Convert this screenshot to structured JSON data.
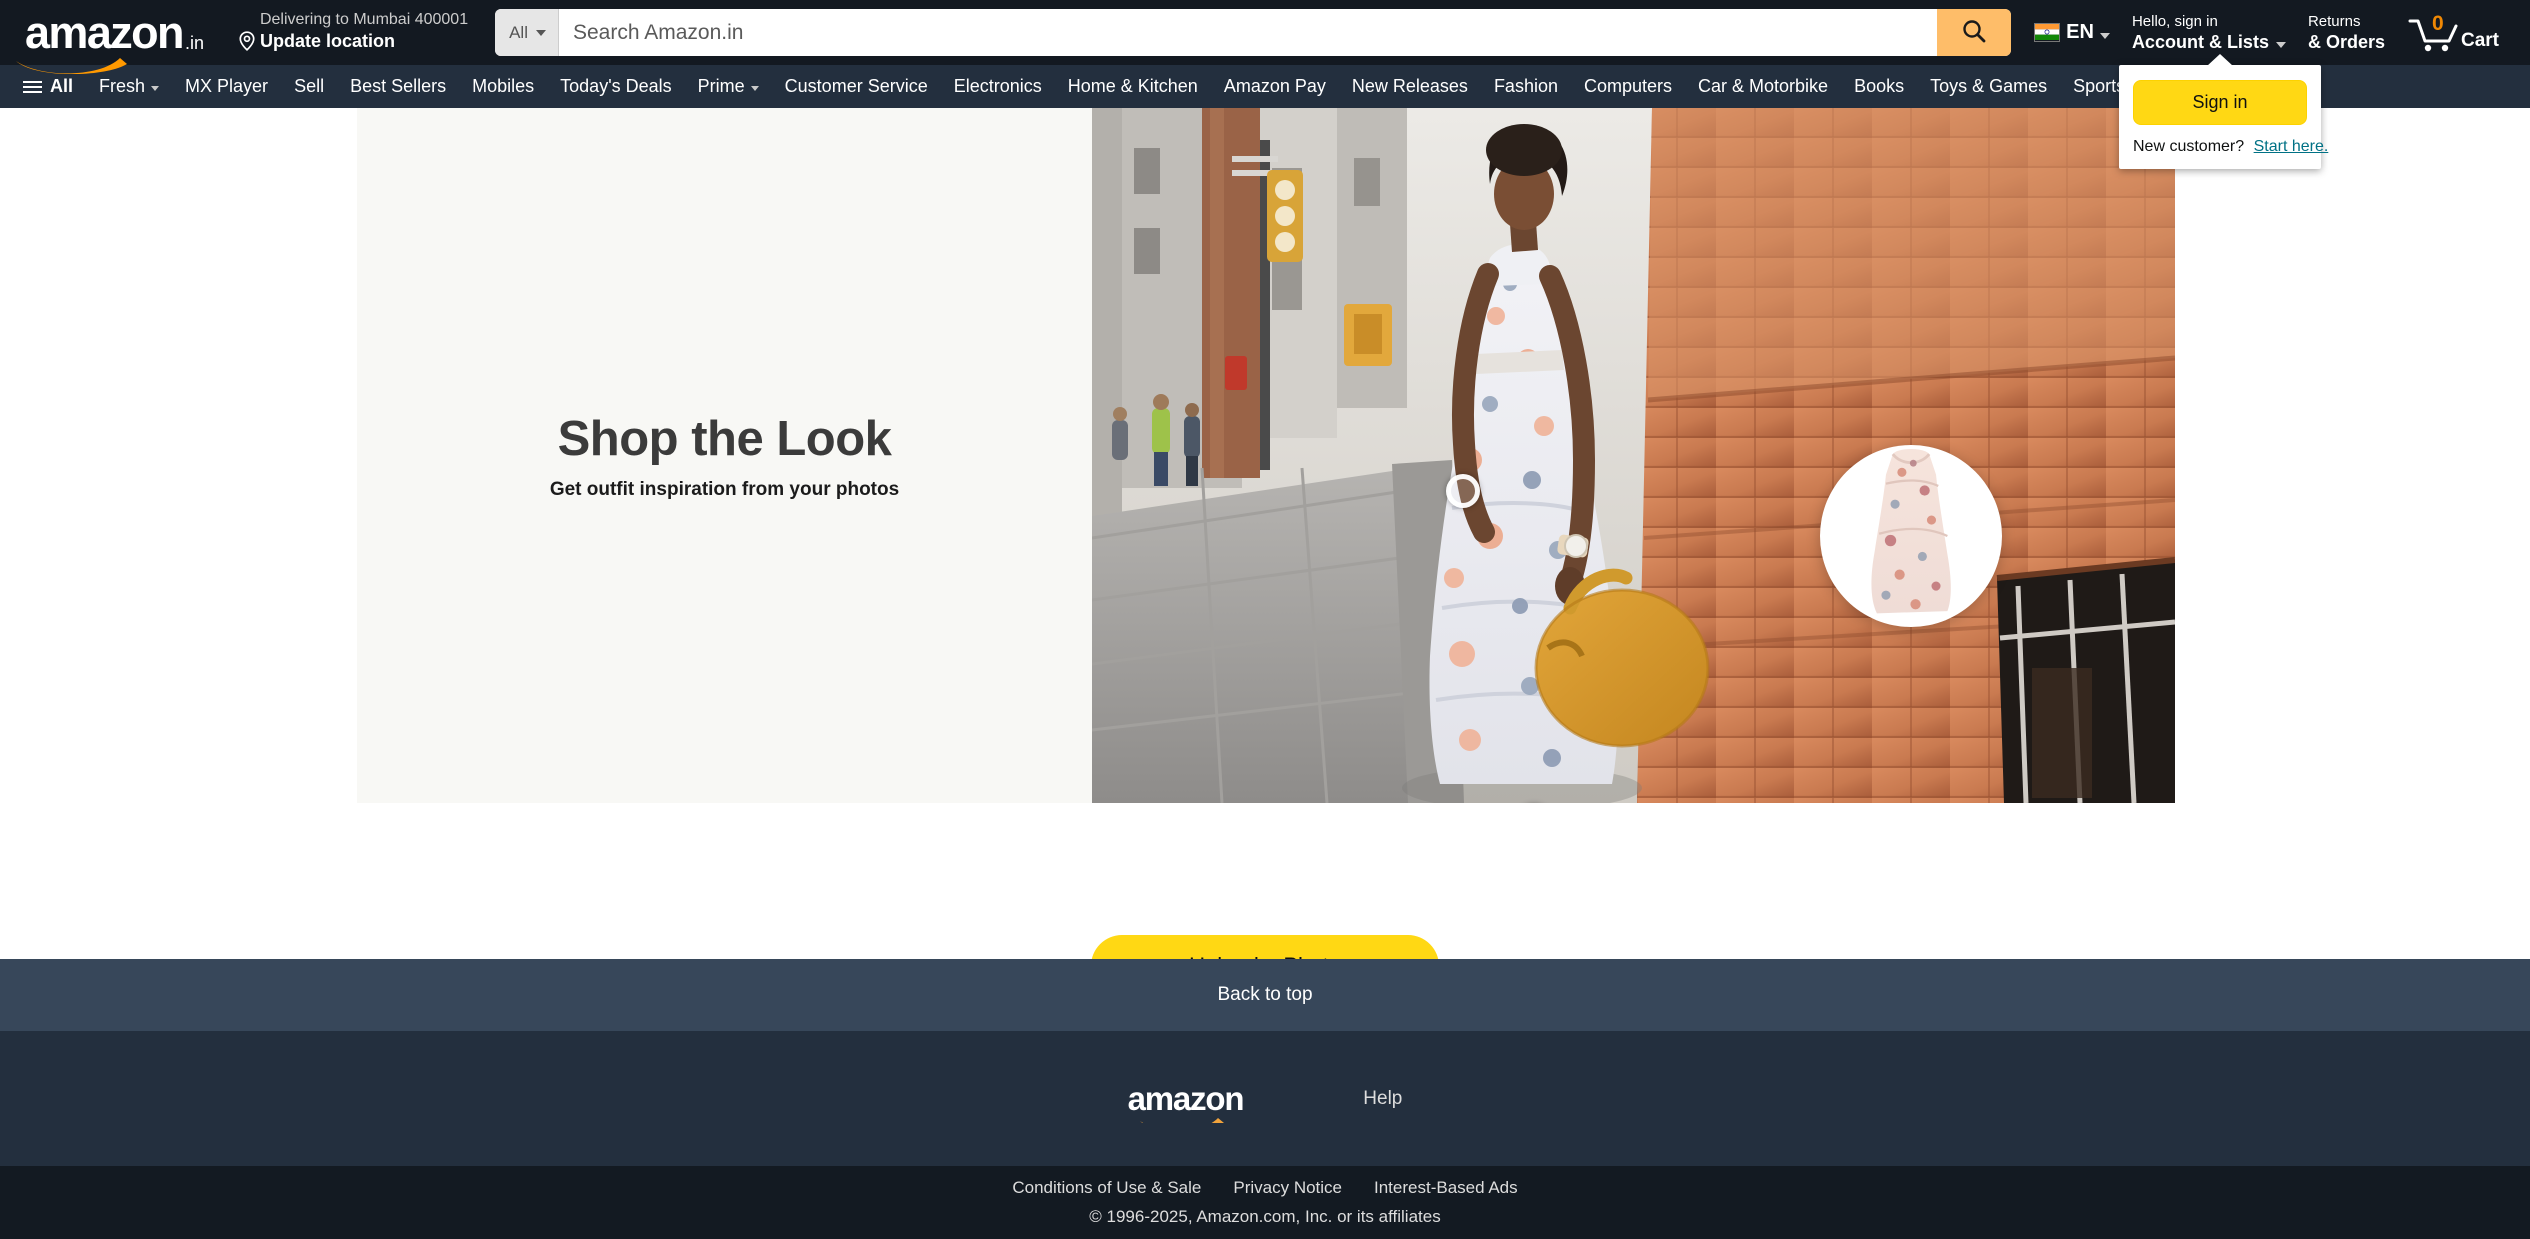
{
  "header": {
    "logo": {
      "word": "amazon",
      "tld": ".in"
    },
    "delivery": {
      "line1": "Delivering to Mumbai 400001",
      "line2": "Update location",
      "icon": "location-pin-icon"
    },
    "search": {
      "category": "All",
      "placeholder": "Search Amazon.in",
      "value": "",
      "button_icon": "search-icon"
    },
    "language": {
      "code": "EN",
      "flag": "india-flag-icon"
    },
    "account": {
      "line1": "Hello, sign in",
      "line2": "Account & Lists"
    },
    "returns": {
      "line1": "Returns",
      "line2": "& Orders"
    },
    "cart": {
      "count": "0",
      "label": "Cart",
      "icon": "shopping-cart-icon"
    }
  },
  "signin_flyout": {
    "signin_label": "Sign in",
    "new_customer_text": "New customer?",
    "start_here_label": "Start here."
  },
  "subnav": {
    "all_label": "All",
    "items": [
      {
        "label": "Fresh",
        "caret": true
      },
      {
        "label": "MX Player",
        "caret": false
      },
      {
        "label": "Sell",
        "caret": false
      },
      {
        "label": "Best Sellers",
        "caret": false
      },
      {
        "label": "Mobiles",
        "caret": false
      },
      {
        "label": "Today's Deals",
        "caret": false
      },
      {
        "label": "Prime",
        "caret": true
      },
      {
        "label": "Customer Service",
        "caret": false
      },
      {
        "label": "Electronics",
        "caret": false
      },
      {
        "label": "Home & Kitchen",
        "caret": false
      },
      {
        "label": "Amazon Pay",
        "caret": false
      },
      {
        "label": "New Releases",
        "caret": false
      },
      {
        "label": "Fashion",
        "caret": false
      },
      {
        "label": "Computers",
        "caret": false
      },
      {
        "label": "Car & Motorbike",
        "caret": false
      },
      {
        "label": "Books",
        "caret": false
      },
      {
        "label": "Toys & Games",
        "caret": false
      },
      {
        "label": "Sports",
        "caret": false
      }
    ]
  },
  "hero": {
    "title": "Shop the Look",
    "subtitle": "Get outfit inspiration from your photos",
    "upload_label": "Upload a Photo",
    "photo_alt": "woman-in-floral-dress-street-photo",
    "product_bubble_alt": "floral-midi-dress-product"
  },
  "footer": {
    "back_to_top": "Back to top",
    "logo_word": "amazon",
    "help_label": "Help",
    "links": [
      "Conditions of Use & Sale",
      "Privacy Notice",
      "Interest-Based Ads"
    ],
    "copyright": "© 1996-2025, Amazon.com, Inc. or its affiliates"
  },
  "colors": {
    "nav_dark": "#131921",
    "nav_sub": "#232f3e",
    "accent_yellow": "#ffd814",
    "search_button": "#febd69",
    "back_to_top": "#37475a",
    "link_teal": "#007185",
    "hero_band": "#f8f8f5"
  }
}
